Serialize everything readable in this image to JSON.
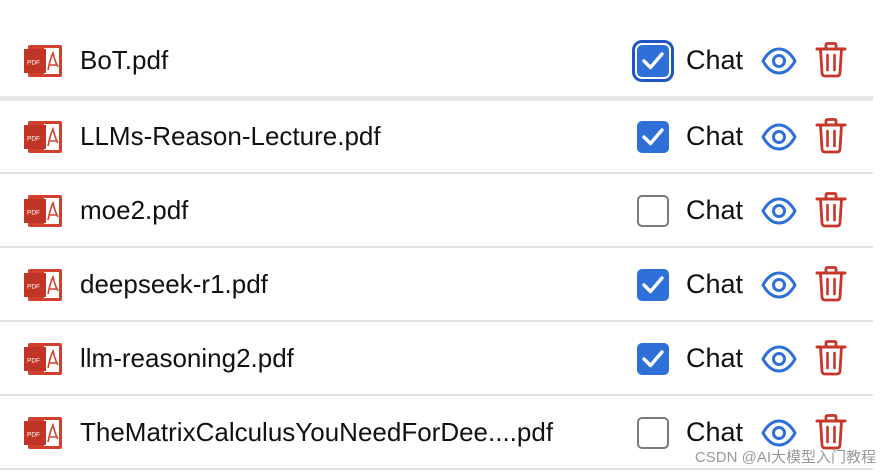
{
  "colors": {
    "checkbox_checked": "#2f6fd8",
    "checkbox_focus_ring": "#1f56c4",
    "view_icon": "#2f6fd8",
    "delete_icon": "#c8352b",
    "pdf_icon": "#d1402f"
  },
  "files": [
    {
      "name": "BoT.pdf",
      "chat_label": "Chat",
      "chat_checked": true,
      "focused": true
    },
    {
      "name": "LLMs-Reason-Lecture.pdf",
      "chat_label": "Chat",
      "chat_checked": true,
      "focused": false
    },
    {
      "name": "moe2.pdf",
      "chat_label": "Chat",
      "chat_checked": false,
      "focused": false
    },
    {
      "name": "deepseek-r1.pdf",
      "chat_label": "Chat",
      "chat_checked": true,
      "focused": false
    },
    {
      "name": "llm-reasoning2.pdf",
      "chat_label": "Chat",
      "chat_checked": true,
      "focused": false
    },
    {
      "name": "TheMatrixCalculusYouNeedForDee....pdf",
      "chat_label": "Chat",
      "chat_checked": false,
      "focused": false
    }
  ],
  "icons": {
    "file": "pdf-file-icon",
    "view": "eye-icon",
    "delete": "trash-icon",
    "check": "checkmark-icon"
  },
  "watermark": "CSDN @AI大模型入门教程"
}
